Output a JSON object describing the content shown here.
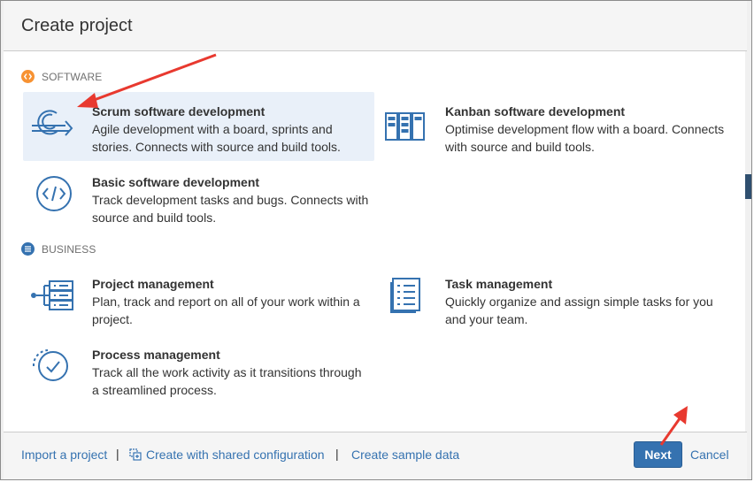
{
  "dialog": {
    "title": "Create project"
  },
  "sections": {
    "software": {
      "label": "SOFTWARE",
      "options": [
        {
          "title": "Scrum software development",
          "desc_lines": [
            "Agile development with a board, sprints and",
            "stories. Connects with source and build tools."
          ],
          "icon": "scrum-icon"
        },
        {
          "title": "Kanban software development",
          "desc_lines": [
            "Optimise development flow with a board. Connects",
            "with source and build tools."
          ],
          "icon": "kanban-icon"
        },
        {
          "title": "Basic software development",
          "desc_lines": [
            "Track development tasks and bugs. Connects with",
            "source and build tools."
          ],
          "icon": "code-icon"
        }
      ]
    },
    "business": {
      "label": "BUSINESS",
      "options": [
        {
          "title": "Project management",
          "desc_lines": [
            "Plan, track and report on all of your work within a",
            "project."
          ],
          "icon": "project-tree-icon"
        },
        {
          "title": "Task management",
          "desc_lines": [
            "Quickly organize and assign simple tasks for you",
            "and your team."
          ],
          "icon": "task-list-icon"
        },
        {
          "title": "Process management",
          "desc_lines": [
            "Track all the work activity as it transitions through",
            "a streamlined process."
          ],
          "icon": "process-check-icon"
        }
      ]
    }
  },
  "footer": {
    "import_label": "Import a project",
    "separator": "|",
    "shared_config_label": "Create with shared configuration",
    "sample_data_label": "Create sample data",
    "next_label": "Next",
    "cancel_label": "Cancel"
  },
  "colors": {
    "accent": "#3572b0",
    "software_badge": "#f79232",
    "selected_bg": "#e9f0f9",
    "annotation_arrow": "#e8392f"
  }
}
